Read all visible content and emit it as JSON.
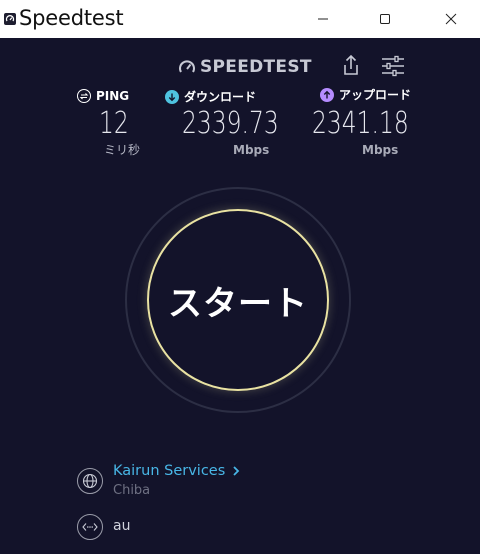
{
  "window": {
    "title": "Speedtest",
    "controls": {
      "minimize_icon": "minimize-icon",
      "maximize_icon": "maximize-icon",
      "close_icon": "close-icon"
    }
  },
  "header": {
    "logo_text": "SPEEDTEST",
    "share_icon": "share-icon",
    "settings_icon": "settings-sliders-icon"
  },
  "metrics": {
    "ping": {
      "label": "PING",
      "value": "12",
      "unit": "ミリ秒",
      "icon": "ping-icon"
    },
    "download": {
      "label": "ダウンロード",
      "value": "2339.73",
      "unit": "Mbps",
      "icon": "download-arrow-icon"
    },
    "upload": {
      "label": "アップロード",
      "value": "2341.18",
      "unit": "Mbps",
      "icon": "upload-arrow-icon"
    }
  },
  "start": {
    "label": "スタート"
  },
  "provider": {
    "name": "Kairun Services",
    "location": "Chiba",
    "icon": "globe-icon"
  },
  "connection": {
    "name": "au",
    "icon": "connection-icon"
  },
  "colors": {
    "background": "#13132a",
    "accent_download": "#4fc3e0",
    "accent_upload": "#b58cff",
    "start_ring": "#e9e2a2",
    "provider_link": "#48b6e6"
  }
}
